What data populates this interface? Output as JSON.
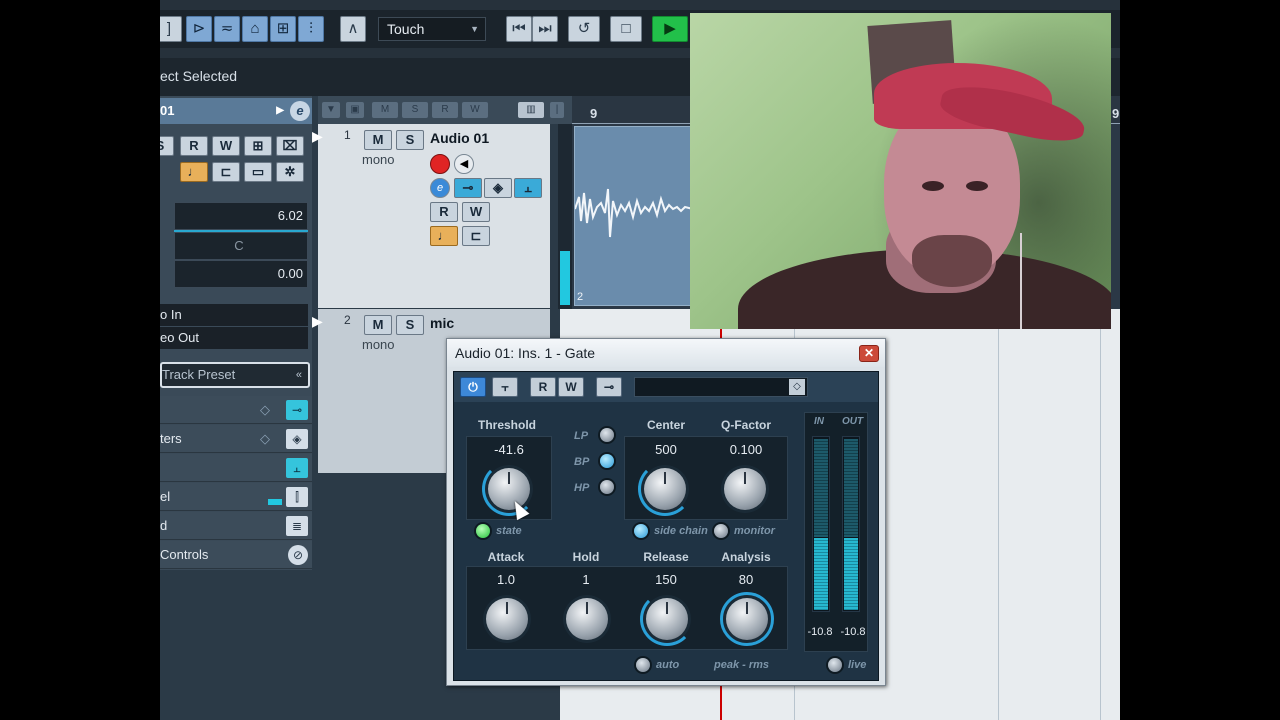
{
  "toolbar": {
    "automation_mode": "Touch"
  },
  "status": {
    "selection_text": "ect Selected"
  },
  "inspector": {
    "track_name_fragment": "01",
    "volume": "6.02",
    "pan": "C",
    "delay": "0.00",
    "input_routing": "o In",
    "output_routing": "eo Out",
    "preset_placeholder": "Track Preset",
    "sections": [
      "",
      "ters",
      "",
      "el",
      "d",
      "Controls"
    ]
  },
  "tracks": [
    {
      "number": "1",
      "name": "Audio 01",
      "channel": "mono"
    },
    {
      "number": "2",
      "name": "mic",
      "channel": "mono"
    }
  ],
  "ruler": {
    "marks": [
      "9",
      "9"
    ]
  },
  "clip": {
    "number": "2"
  },
  "gate": {
    "title": "Audio 01: Ins. 1 - Gate",
    "threshold": {
      "label": "Threshold",
      "value": "-41.6"
    },
    "filter": {
      "lp": "LP",
      "bp": "BP",
      "hp": "HP"
    },
    "center": {
      "label": "Center",
      "value": "500"
    },
    "qfactor": {
      "label": "Q-Factor",
      "value": "0.100"
    },
    "state_label": "state",
    "side_chain_label": "side chain",
    "monitor_label": "monitor",
    "attack": {
      "label": "Attack",
      "value": "1.0"
    },
    "hold": {
      "label": "Hold",
      "value": "1"
    },
    "release": {
      "label": "Release",
      "value": "150"
    },
    "analysis": {
      "label": "Analysis",
      "value": "80"
    },
    "auto_label": "auto",
    "peak_rms_label": "peak - rms",
    "live_label": "live",
    "meter": {
      "in_label": "IN",
      "out_label": "OUT",
      "in_value": "-10.8",
      "out_value": "-10.8"
    }
  },
  "colors": {
    "accent": "#2aa0d8",
    "play_green": "#22c04a",
    "record_red": "#e02424"
  }
}
